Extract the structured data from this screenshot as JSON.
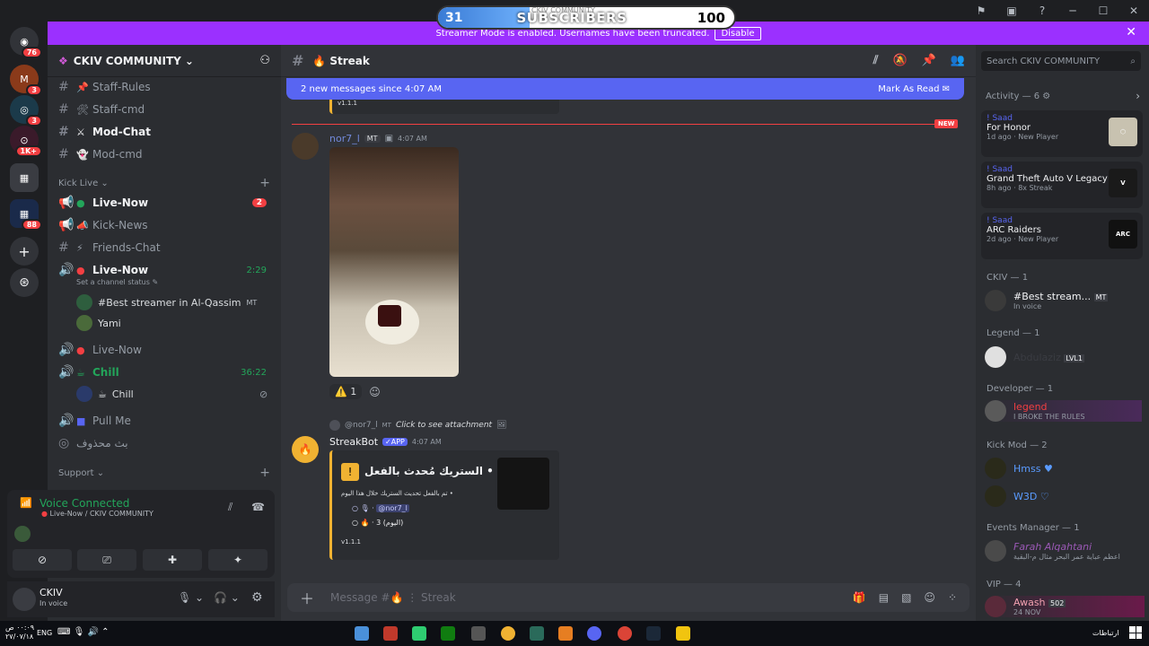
{
  "overlay": {
    "current": "31",
    "label": "SUBSCRIBERS",
    "goal": "100",
    "tag": "CKIV COMMUNITY",
    "progress_fraction": 0.31
  },
  "banner": {
    "text": "Streamer Mode is enabled. Usernames have been truncated.",
    "disable": "Disable"
  },
  "rail": {
    "badges": [
      "76",
      "3",
      "3",
      "1K+",
      "88"
    ]
  },
  "server": {
    "name": "CKIV COMMUNITY"
  },
  "channels": [
    {
      "emoji": "📌",
      "name": "Staff-Rules"
    },
    {
      "emoji": "🛠",
      "name": "Staff-cmd"
    },
    {
      "emoji": "⚔",
      "name": "Mod-Chat"
    },
    {
      "emoji": "👻",
      "name": "Mod-cmd"
    }
  ],
  "kick_live": {
    "category": "Kick Live",
    "channels": [
      {
        "name": "Live-Now",
        "badge": "2"
      },
      {
        "name": "Kick-News"
      },
      {
        "name": "Friends-Chat"
      }
    ],
    "voice_live": {
      "name": "Live-Now",
      "time": "2:29",
      "status": "Set a channel status"
    },
    "voice_users": [
      {
        "name": "#Best streamer in Al-Qassim",
        "tag": "MT"
      },
      {
        "name": "Yami"
      }
    ],
    "live_now_2": "Live-Now",
    "chill": {
      "name": "Chill",
      "time": "36:22",
      "user": "Chill"
    },
    "pull_me": "Pull Me",
    "arabic": "بث محذوف"
  },
  "support_category": "Support",
  "voice_panel": {
    "status": "Voice Connected",
    "location": "Live-Now / CKIV COMMUNITY"
  },
  "user_panel": {
    "name": "CKIV",
    "status": "In voice"
  },
  "chat": {
    "channel": "Streak",
    "new_messages": "2 new messages since 4:07 AM",
    "mark_read": "Mark As Read",
    "new_label": "NEW",
    "msg1": {
      "author": "nor7_l",
      "tag": "MT",
      "time": "4:07 AM",
      "reaction_count": "1"
    },
    "reply": {
      "author": "@nor7_l",
      "tag": "MT",
      "text": "Click to see attachment"
    },
    "msg2": {
      "author": "StreakBot",
      "app": "APP",
      "time": "4:07 AM"
    },
    "embed": {
      "title": "الستريك مُحدث بالفعل",
      "line1": "تم بالفعل تحديث الستريك خلال هذا اليوم",
      "mention": "@nor7_l",
      "streak": "3 (اليوم)",
      "version": "v1.1.1"
    },
    "top_version": "v1.1.1",
    "composer": "Message #🔥 ⋮ Streak"
  },
  "members": {
    "search": "Search CKIV COMMUNITY",
    "activity_label": "Activity — 6",
    "activities": [
      {
        "user": "! Saad",
        "game": "For Honor",
        "meta": "1d ago · New Player"
      },
      {
        "user": "! Saad",
        "game": "Grand Theft Auto V Legacy",
        "meta": "8h ago · 8x Streak"
      },
      {
        "user": "! Saad",
        "game": "ARC Raiders",
        "meta": "2d ago · New Player"
      }
    ],
    "roles": [
      {
        "role": "CKIV — 1",
        "members": [
          {
            "name": "#Best stream...",
            "tag": "MT",
            "status": "In voice"
          }
        ]
      },
      {
        "role": "Legend — 1",
        "members": [
          {
            "name": "Abdulaziz",
            "tag": "LVL1"
          }
        ]
      },
      {
        "role": "Developer — 1",
        "members": [
          {
            "name": "legend",
            "status": "I BROKE THE RULES"
          }
        ]
      },
      {
        "role": "Kick Mod — 2",
        "members": [
          {
            "name": "Hmss"
          },
          {
            "name": "W3D"
          }
        ]
      },
      {
        "role": "Events Manager — 1",
        "members": [
          {
            "name": "Farah Alqahtani",
            "status": "اعظم عباية عمر البحر مثال م-البقية"
          }
        ]
      },
      {
        "role": "VIP — 4",
        "members": [
          {
            "name": "Awash",
            "tag": "502",
            "status": "24 NOV"
          }
        ]
      }
    ]
  },
  "taskbar": {
    "lang": "ENG",
    "time": "٠٠:٠٩ ص",
    "date": "٢٧/٠٧/١٨",
    "right": "ارتباطات"
  }
}
